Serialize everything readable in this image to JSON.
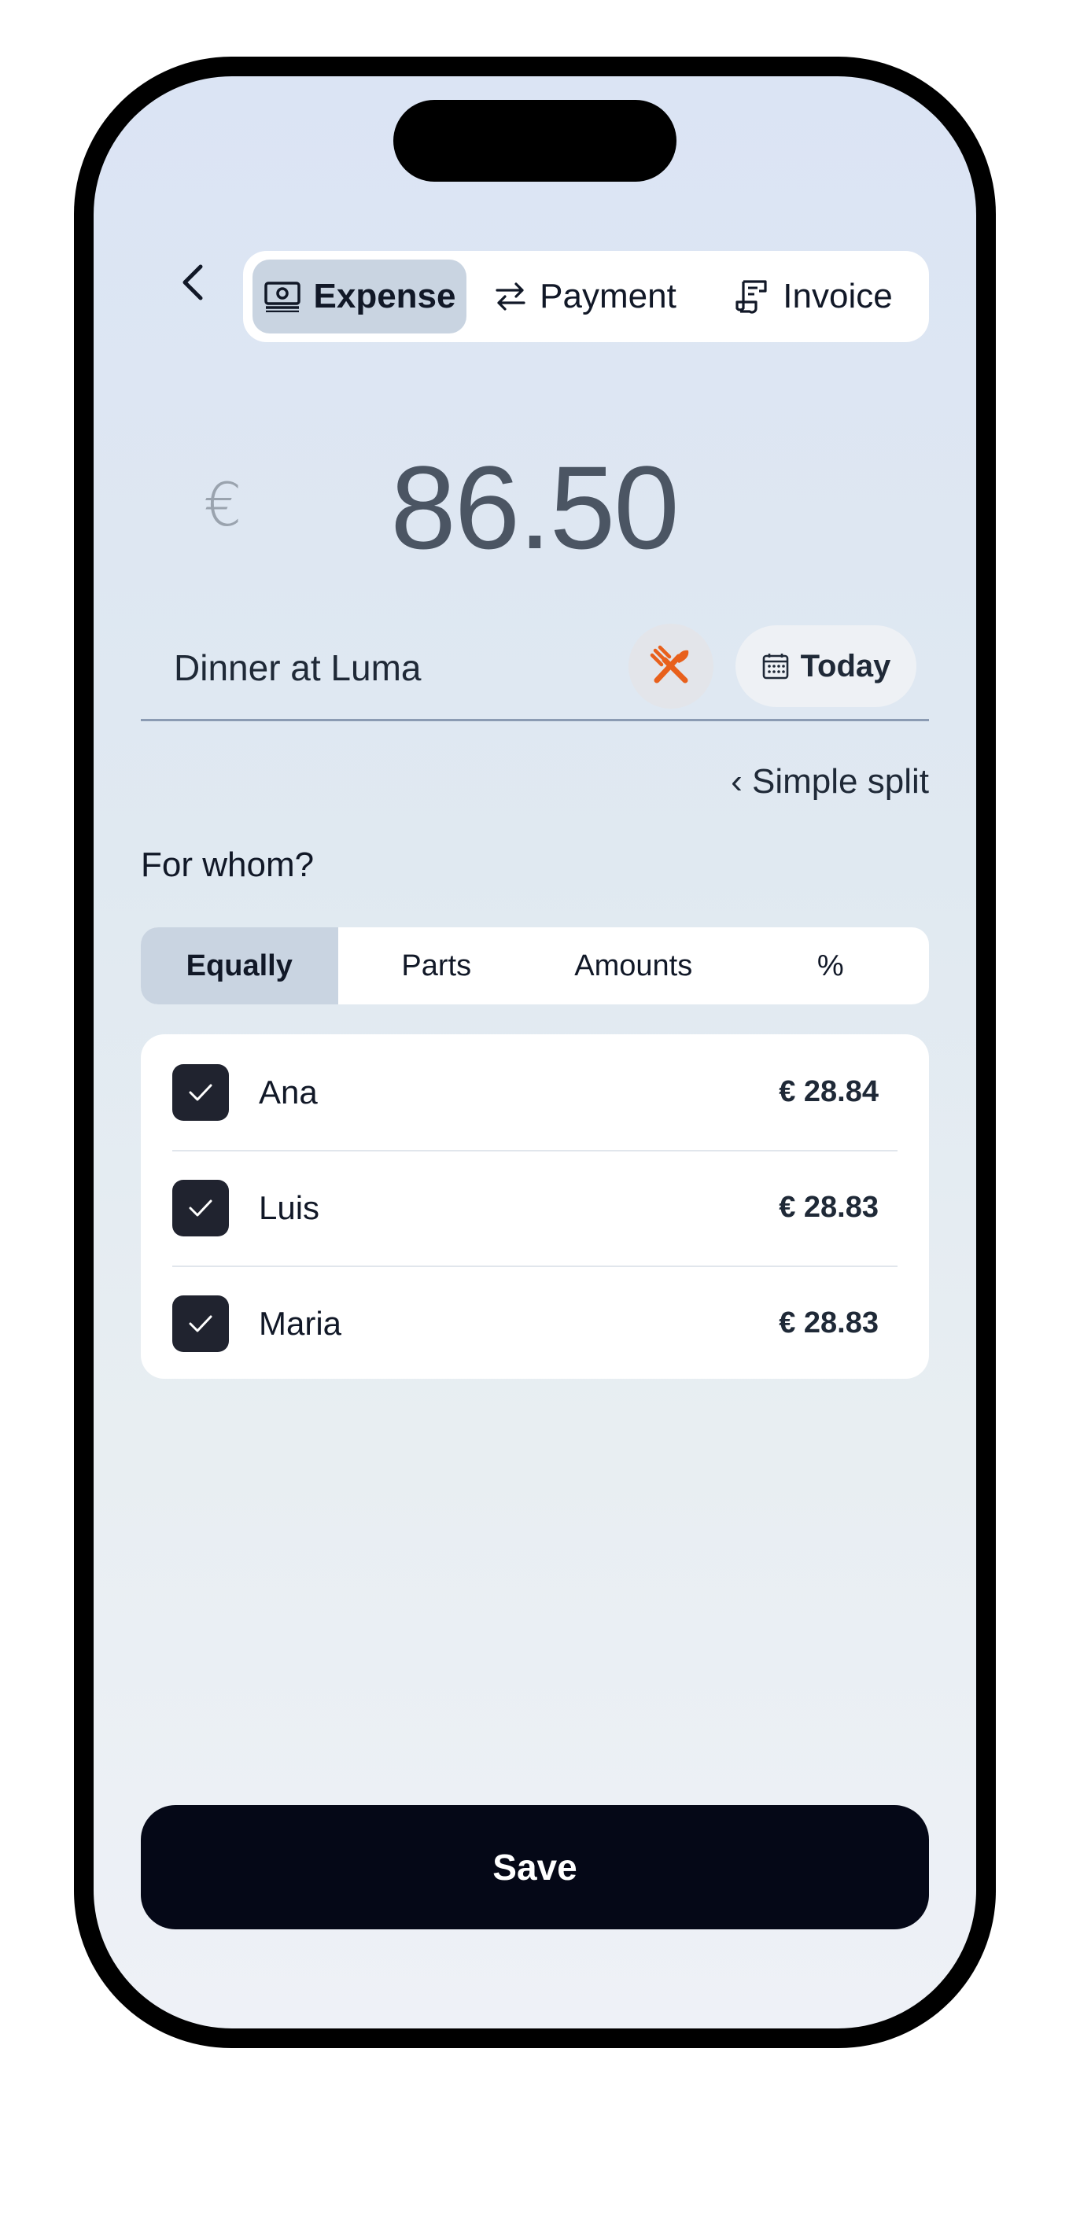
{
  "header": {
    "back_icon": "chevron-left-icon",
    "tabs": [
      {
        "label": "Expense",
        "icon": "banknote-icon",
        "active": true
      },
      {
        "label": "Payment",
        "icon": "transfer-arrows-icon",
        "active": false
      },
      {
        "label": "Invoice",
        "icon": "receipt-icon",
        "active": false
      }
    ]
  },
  "amount": {
    "currency_symbol": "€",
    "value": "86.50"
  },
  "description": {
    "value": "Dinner at Luma"
  },
  "category": {
    "icon": "fork-knife-icon",
    "color": "#e8601c"
  },
  "date": {
    "icon": "calendar-icon",
    "label": "Today"
  },
  "simple_split_link": "‹ Simple split",
  "split": {
    "heading": "For whom?",
    "modes": [
      {
        "label": "Equally",
        "active": true
      },
      {
        "label": "Parts",
        "active": false
      },
      {
        "label": "Amounts",
        "active": false
      },
      {
        "label": "%",
        "active": false
      }
    ],
    "people": [
      {
        "name": "Ana",
        "amount": "€ 28.84",
        "checked": true
      },
      {
        "name": "Luis",
        "amount": "€ 28.83",
        "checked": true
      },
      {
        "name": "Maria",
        "amount": "€ 28.83",
        "checked": true
      }
    ]
  },
  "save_label": "Save",
  "colors": {
    "active_tab": "#c9d4e1",
    "primary_button": "#050817",
    "checkbox": "#20232f"
  }
}
